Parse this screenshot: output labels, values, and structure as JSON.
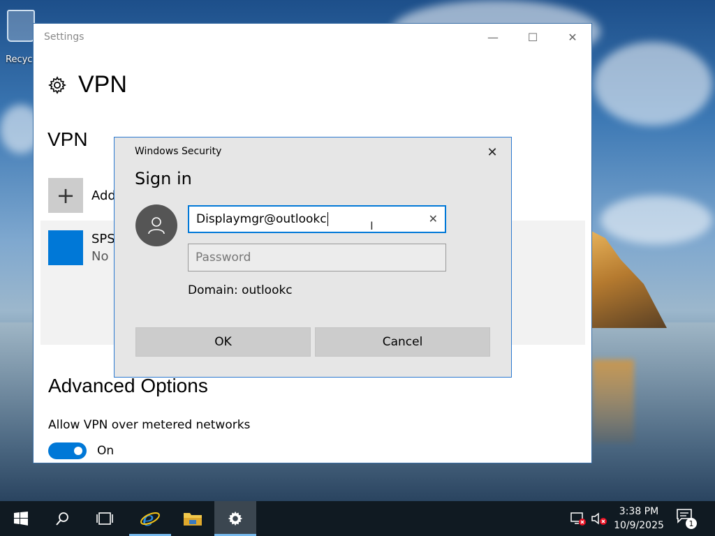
{
  "desktop": {
    "recycle_bin_label": "Recyc"
  },
  "settings": {
    "window_title": "Settings",
    "page_title": "VPN",
    "section_title": "VPN",
    "add_vpn_label": "Add",
    "connection": {
      "name": "SPS",
      "status": "No"
    },
    "advanced_title": "Advanced Options",
    "metered_label": "Allow VPN over metered networks",
    "metered_toggle_state": "On"
  },
  "dialog": {
    "title": "Windows Security",
    "heading": "Sign in",
    "username_value": "Displaymgr@outlookc",
    "password_placeholder": "Password",
    "domain_text": "Domain: outlookc",
    "ok_label": "OK",
    "cancel_label": "Cancel"
  },
  "taskbar": {
    "time": "3:38 PM",
    "date": "10/9/2025",
    "notification_count": "1"
  },
  "colors": {
    "accent": "#0078d7",
    "dialog_border": "#2b79d0",
    "taskbar": "#101a22"
  }
}
